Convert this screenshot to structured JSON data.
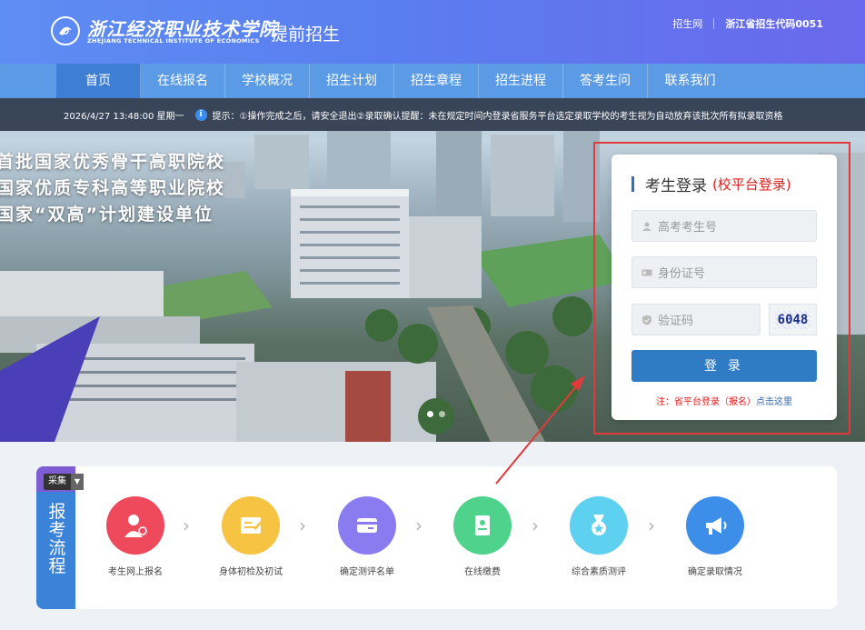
{
  "header": {
    "logo_cn": "浙江经济职业技术学院",
    "logo_en": "ZHEJIANG TECHNICAL INSTITUTE OF ECONOMICS",
    "suffix": "提前招生",
    "links": [
      "招生网",
      "浙江省招生代码0051"
    ]
  },
  "nav": {
    "items": [
      "首页",
      "在线报名",
      "学校概况",
      "招生计划",
      "招生章程",
      "招生进程",
      "答考生问",
      "联系我们"
    ],
    "active": "首页"
  },
  "notice": {
    "datetime": "2026/4/27 13:48:00 星期一",
    "text": "提示：①操作完成之后，请安全退出②录取确认提醒：未在规定时间内登录省服务平台选定录取学校的考生视为自动放弃该批次所有拟录取资格"
  },
  "banner": {
    "slogans": [
      "首批国家优秀骨干高职院校",
      "国家优质专科高等职业院校",
      "国家“双高”计划建设单位"
    ],
    "slide_count": 2,
    "active_slide": 0
  },
  "login": {
    "title": "考生登录",
    "subtitle": "(校平台登录)",
    "exam_id_placeholder": "高考考生号",
    "id_card_placeholder": "身份证号",
    "captcha_placeholder": "验证码",
    "captcha_code": "6048",
    "submit_label": "登 录",
    "note_prefix": "注：省平台登录（报名）",
    "note_link": "点击这里"
  },
  "process": {
    "tag": "采集",
    "title": "报考流程",
    "steps": [
      {
        "label": "考生网上报名",
        "icon": "doctor-icon",
        "color": "#ef4a5c"
      },
      {
        "label": "身体初检及初试",
        "icon": "form-edit-icon",
        "color": "#f6c343"
      },
      {
        "label": "确定测评名单",
        "icon": "card-icon",
        "color": "#8a7cf0"
      },
      {
        "label": "在线缴费",
        "icon": "id-badge-icon",
        "color": "#4fd38c"
      },
      {
        "label": "综合素质测评",
        "icon": "medal-icon",
        "color": "#5ed0f0"
      },
      {
        "label": "确定录取情况",
        "icon": "megaphone-icon",
        "color": "#3d8ee8"
      }
    ]
  }
}
